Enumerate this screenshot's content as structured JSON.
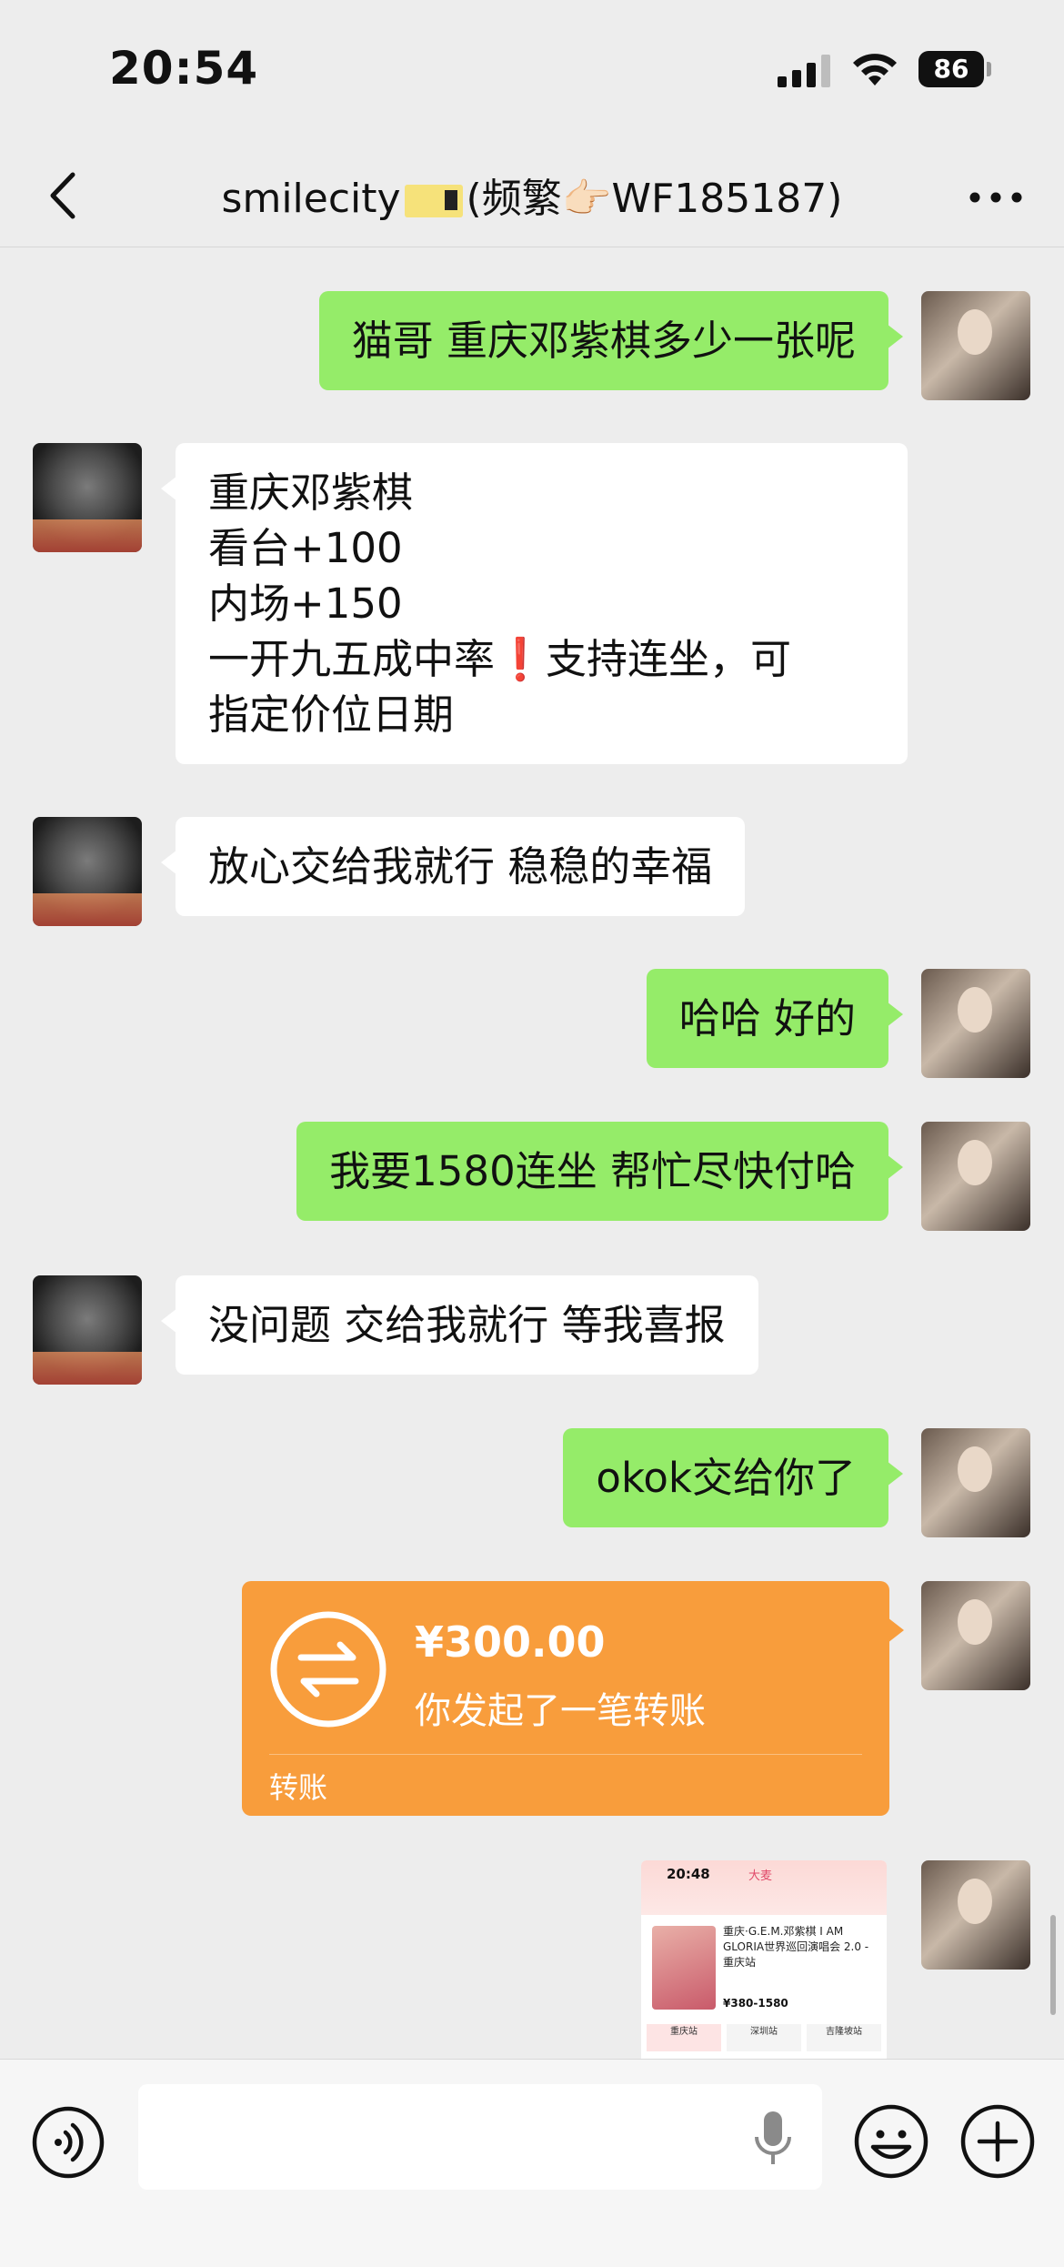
{
  "status_bar": {
    "time": "20:54",
    "battery": "86"
  },
  "header": {
    "title_before": "smilecity",
    "title_after": "(频繁👉🏻WF185187)",
    "back_icon": "chevron-left-icon",
    "more_icon": "more-icon"
  },
  "messages": [
    {
      "from": "me",
      "text": "猫哥 重庆邓紫棋多少一张呢"
    },
    {
      "from": "other",
      "lines": [
        "重庆邓紫棋",
        "看台+100",
        "内场+150",
        "一开九五成中率",
        "❗",
        "支持连坐，可",
        "指定价位日期"
      ]
    },
    {
      "from": "other",
      "text": "放心交给我就行 稳稳的幸福"
    },
    {
      "from": "me",
      "text": "哈哈 好的"
    },
    {
      "from": "me",
      "text": "我要1580连坐 帮忙尽快付哈"
    },
    {
      "from": "other",
      "text": "没问题 交给我就行 等我喜报"
    },
    {
      "from": "me",
      "text": "okok交给你了"
    }
  ],
  "transfer": {
    "amount": "¥300.00",
    "description": "你发起了一笔转账",
    "label": "转账",
    "color": "#f89d3c"
  },
  "screenshot_thumb": {
    "time": "20:48",
    "brand": "大麦",
    "title": "重庆·G.E.M.邓紫棋 I AM GLORIA世界巡回演唱会 2.0 - 重庆站",
    "price": "¥380-1580",
    "sessions": [
      "重庆站",
      "深圳站",
      "吉隆坡站"
    ]
  },
  "colors": {
    "my_bubble": "#95ec69",
    "other_bubble": "#ffffff",
    "background": "#ededed"
  },
  "input_bar": {
    "voice_icon": "voice-icon",
    "mic_icon": "mic-icon",
    "emoji_icon": "emoji-icon",
    "plus_icon": "plus-icon"
  }
}
